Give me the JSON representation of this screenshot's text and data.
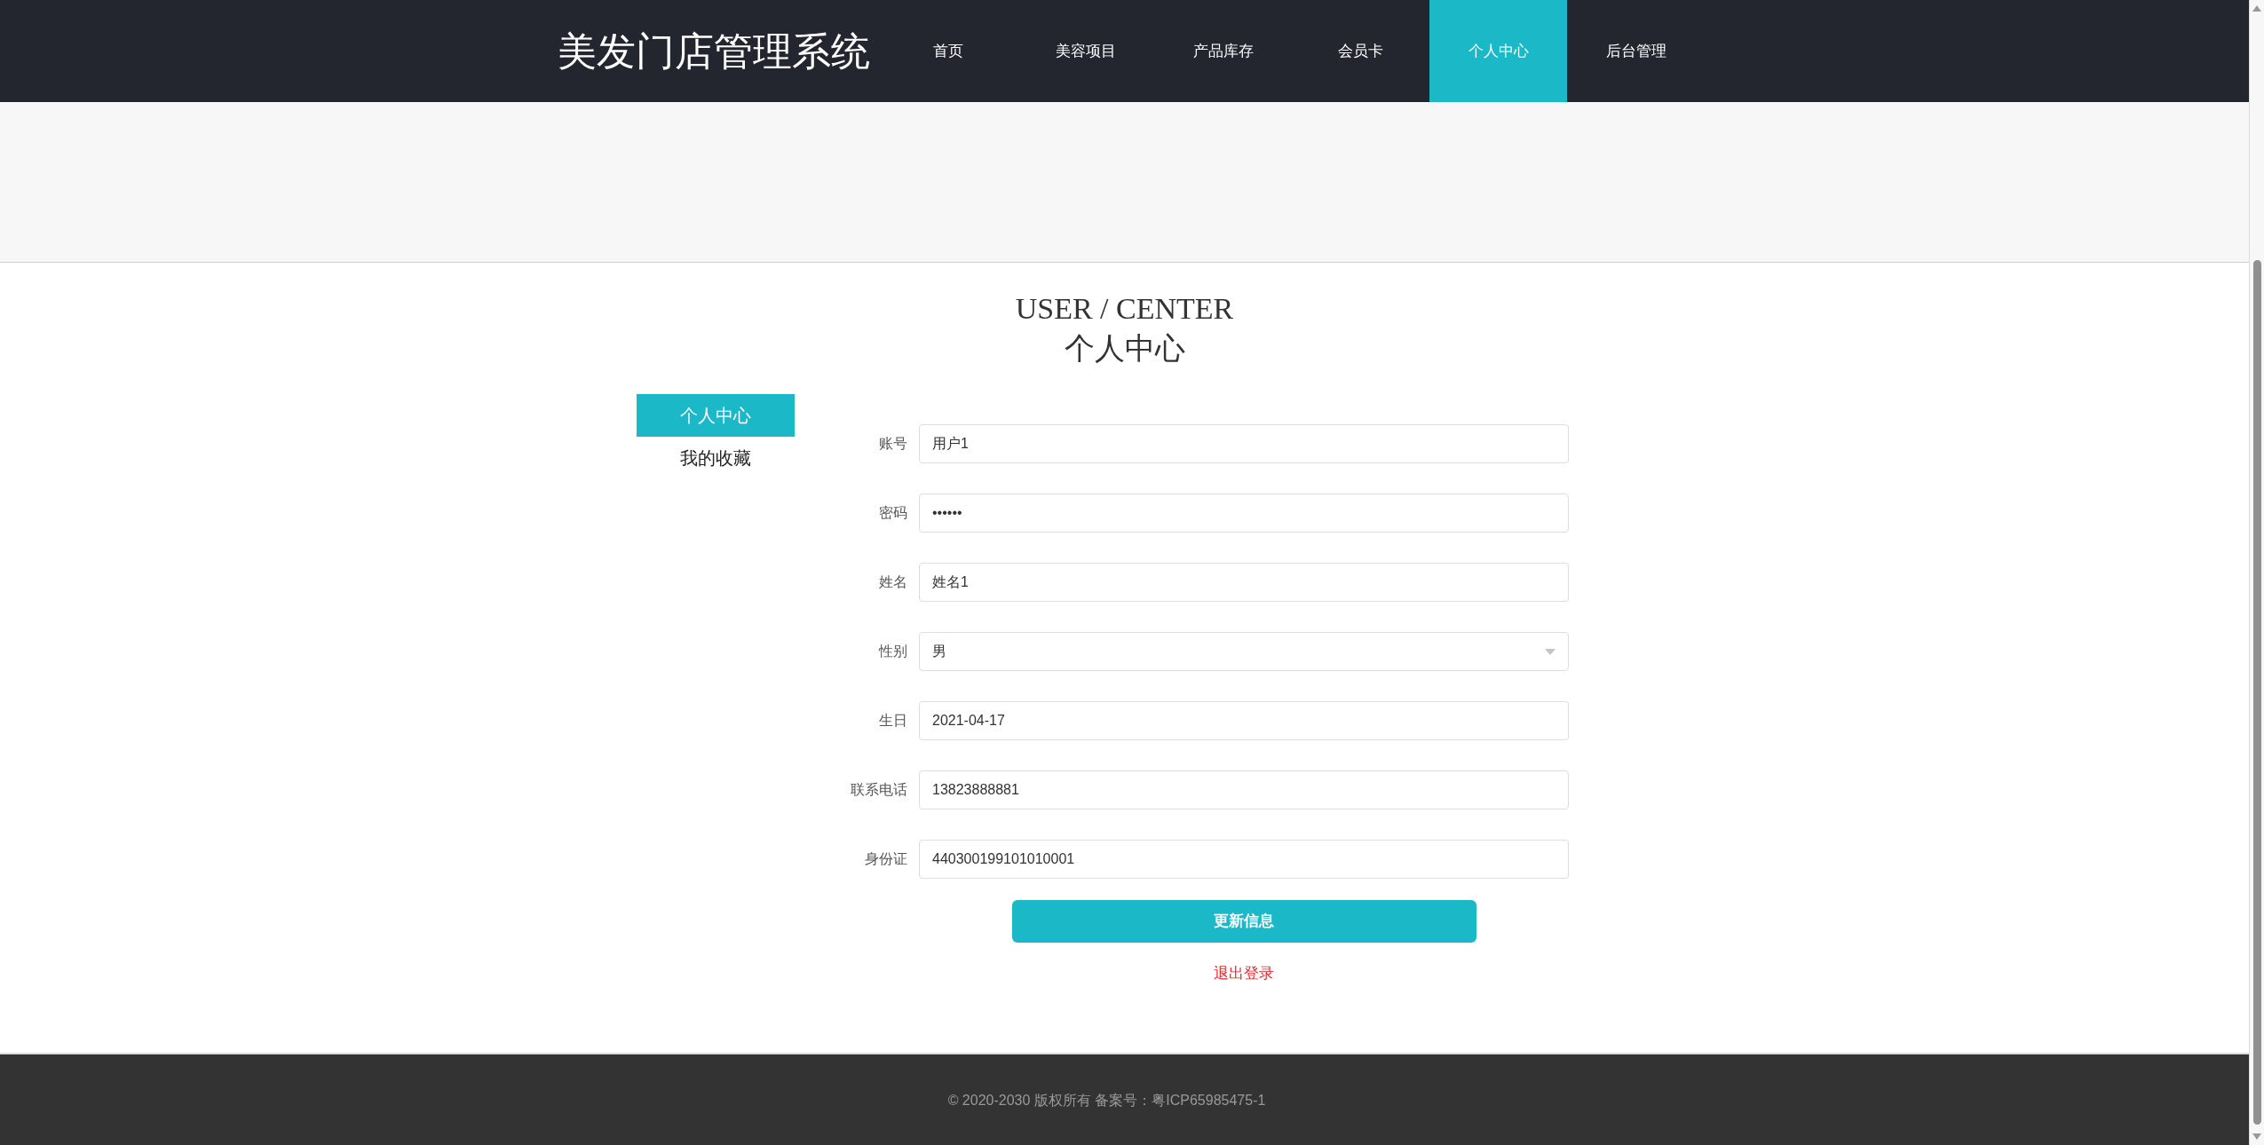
{
  "header": {
    "brand": "美发门店管理系统",
    "nav": [
      {
        "label": "首页",
        "selected": false
      },
      {
        "label": "美容项目",
        "selected": false
      },
      {
        "label": "产品库存",
        "selected": false
      },
      {
        "label": "会员卡",
        "selected": false
      },
      {
        "label": "个人中心",
        "selected": true
      },
      {
        "label": "后台管理",
        "selected": false
      }
    ]
  },
  "page_title": {
    "english": "USER / CENTER",
    "chinese": "个人中心"
  },
  "sidebar": {
    "items": [
      {
        "label": "个人中心",
        "selected": true
      },
      {
        "label": "我的收藏",
        "selected": false
      }
    ]
  },
  "form": {
    "fields": [
      {
        "kind": "text",
        "label": "账号",
        "value": "用户1"
      },
      {
        "kind": "text",
        "label": "密码",
        "value": "••••••"
      },
      {
        "kind": "text",
        "label": "姓名",
        "value": "姓名1"
      },
      {
        "kind": "select",
        "label": "性别",
        "value": "男"
      },
      {
        "kind": "text",
        "label": "生日",
        "value": "2021-04-17"
      },
      {
        "kind": "text",
        "label": "联系电话",
        "value": "13823888881"
      },
      {
        "kind": "text",
        "label": "身份证",
        "value": "440300199101010001"
      }
    ],
    "submit": "更新信息",
    "logout": "退出登录"
  },
  "footer": {
    "text": "© 2020-2030 版权所有 备案号：粤ICP65985475-1"
  }
}
